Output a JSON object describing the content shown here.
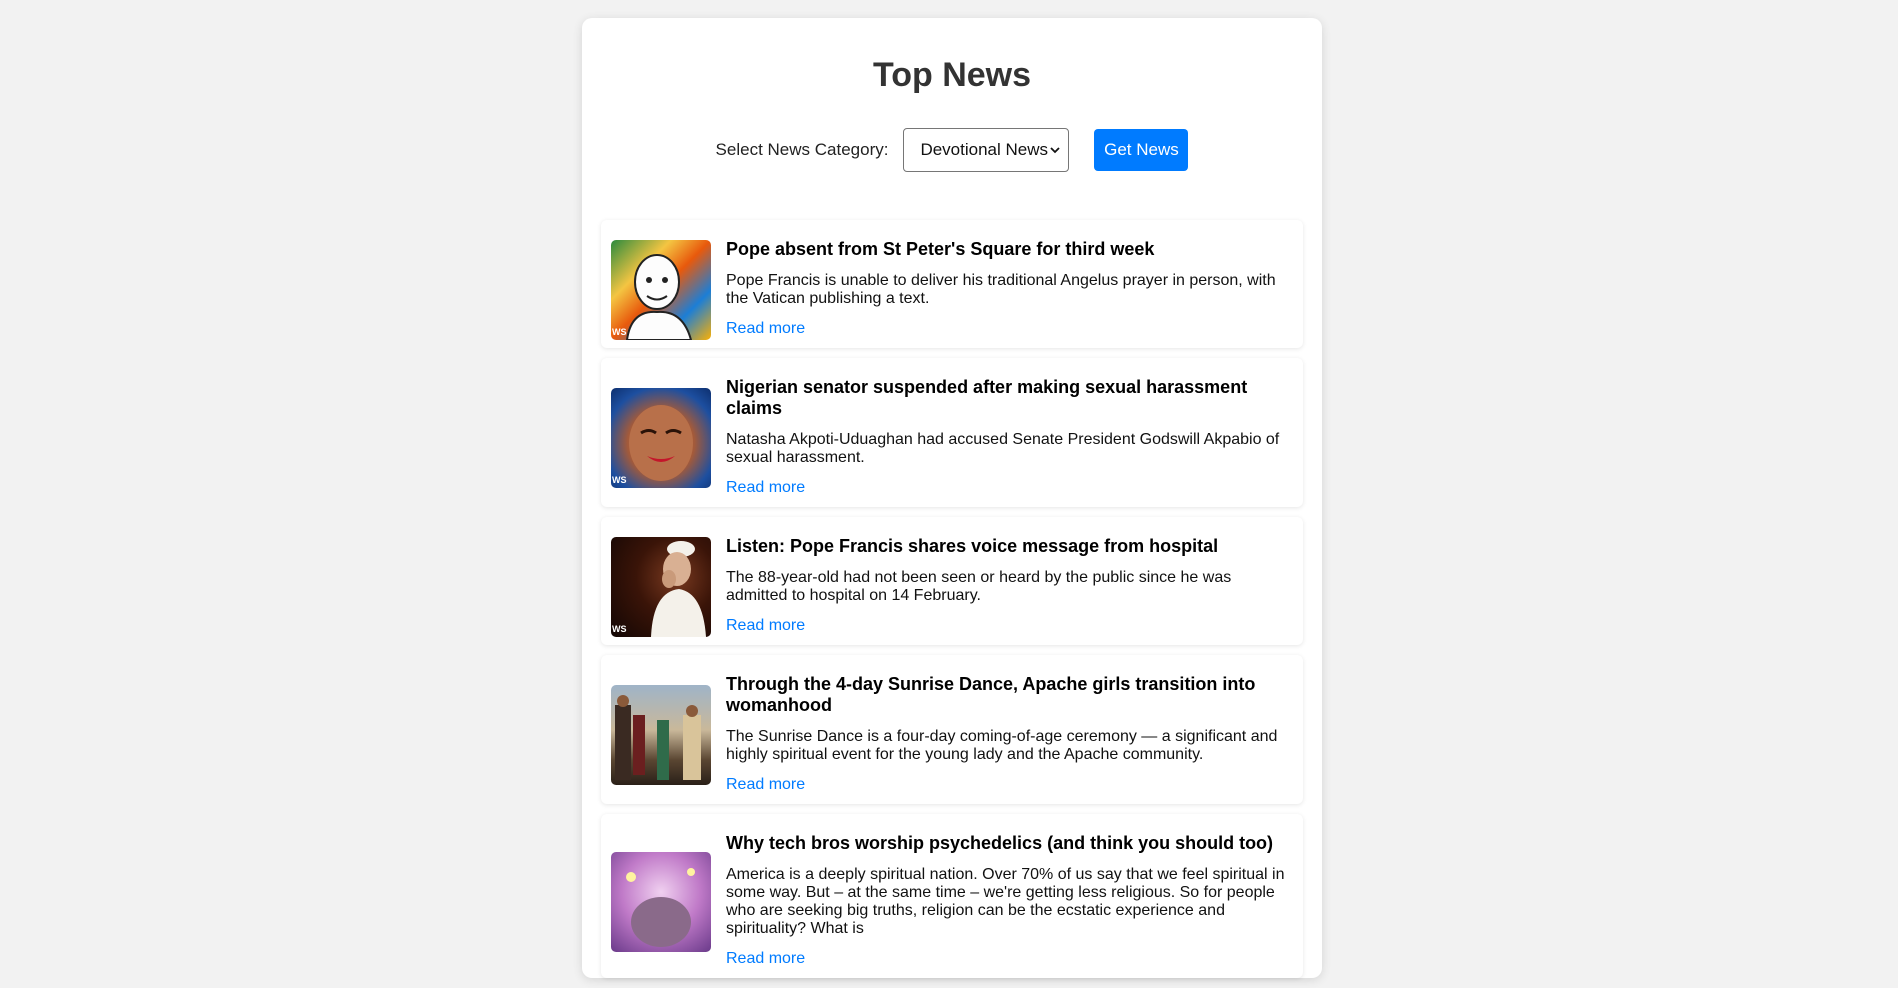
{
  "page": {
    "title": "Top News"
  },
  "controls": {
    "category_label": "Select News Category:",
    "selected_category": "Devotional News",
    "button_label": "Get News"
  },
  "colors": {
    "accent": "#007bff",
    "background": "#f2f2f2"
  },
  "articles": [
    {
      "headline": "Pope absent from St Peter's Square for third week",
      "summary": "Pope Francis is unable to deliver his traditional Angelus prayer in person, with the Vatican publishing a text.",
      "link_label": "Read more"
    },
    {
      "headline": "Nigerian senator suspended after making sexual harassment claims",
      "summary": "Natasha Akpoti-Uduaghan had accused Senate President Godswill Akpabio of sexual harassment.",
      "link_label": "Read more"
    },
    {
      "headline": "Listen: Pope Francis shares voice message from hospital",
      "summary": "The 88-year-old had not been seen or heard by the public since he was admitted to hospital on 14 February.",
      "link_label": "Read more"
    },
    {
      "headline": "Through the 4-day Sunrise Dance, Apache girls transition into womanhood",
      "summary": "The Sunrise Dance is a four-day coming-of-age ceremony — a significant and highly spiritual event for the young lady and the Apache community.",
      "link_label": "Read more"
    },
    {
      "headline": "Why tech bros worship psychedelics (and think you should too)",
      "summary": "America is a deeply spiritual nation. Over 70% of us say that we feel spiritual in some way. But – at the same time – we're getting less religious. So for people who are seeking big truths, religion can be the ecstatic experience and spirituality? What is",
      "link_label": "Read more"
    }
  ]
}
